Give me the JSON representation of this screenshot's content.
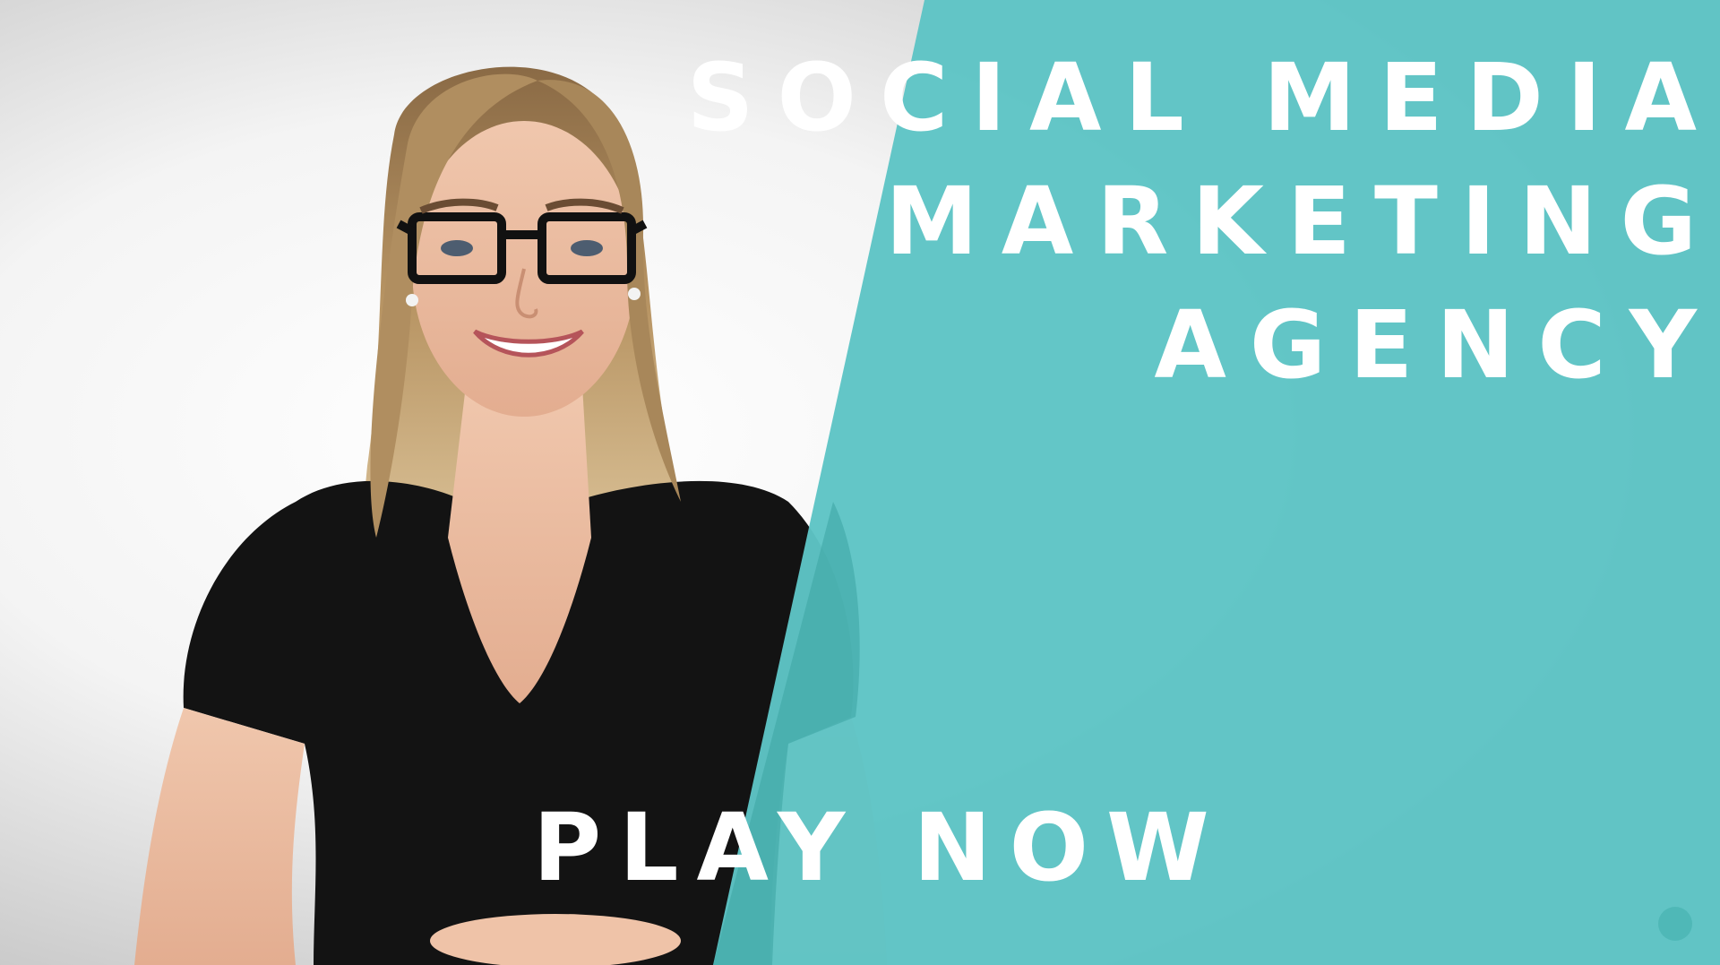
{
  "headline": {
    "line1": "SOCIAL MEDIA",
    "line2": "MARKETING",
    "line3": "AGENCY"
  },
  "cta": {
    "label": "PLAY NOW"
  },
  "colors": {
    "panel": "#5ec4c5",
    "panel_dark": "#3fa6a5",
    "background_center": "#ffffff",
    "background_edge": "#bdbdbd",
    "text": "#ffffff"
  },
  "icons": {
    "corner_dot": "round-dot-icon"
  }
}
